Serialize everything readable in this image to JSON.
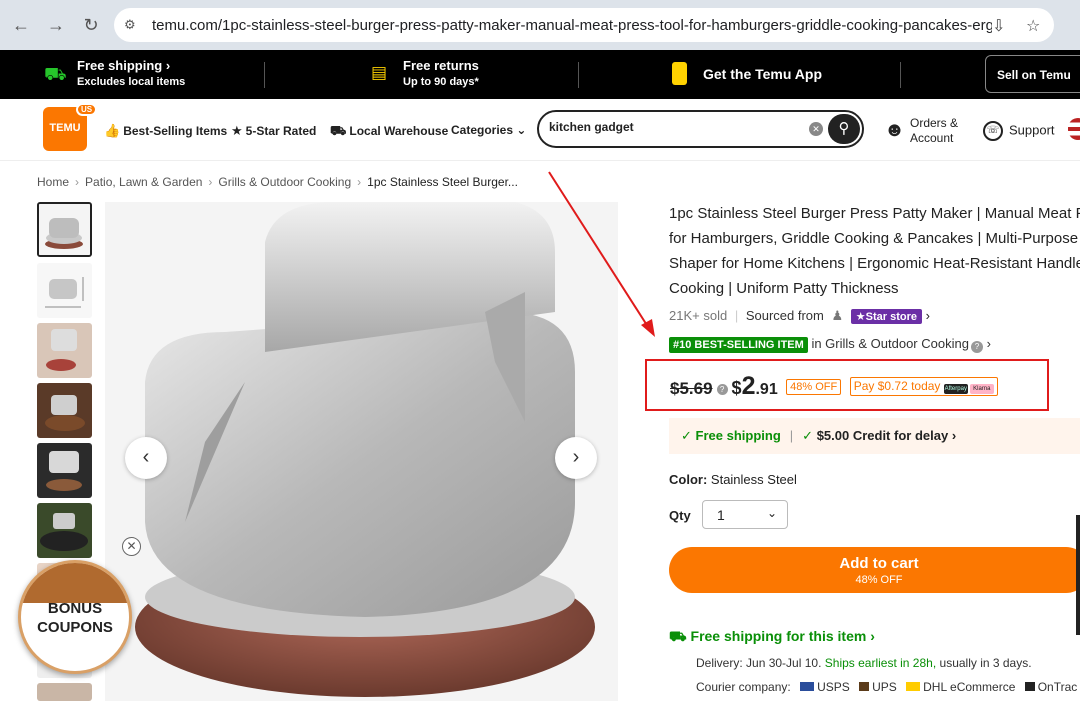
{
  "browser": {
    "url": "temu.com/1pc-stainless-steel-burger-press-patty-maker-manual-meat-press-tool-for-hamburgers-griddle-cooking-pancakes-ergonomic-..."
  },
  "promo": {
    "free_shipping_title": "Free shipping",
    "free_shipping_sub": "Excludes local items",
    "free_returns_title": "Free returns",
    "free_returns_sub": "Up to 90 days*",
    "app_label": "Get the Temu App",
    "sell_label": "Sell on Temu"
  },
  "header": {
    "logo_text": "TEMU",
    "logo_badge": "US",
    "nav": {
      "best_selling": "Best-Selling Items",
      "five_star": "5-Star Rated",
      "local_warehouse": "Local Warehouse",
      "categories": "Categories"
    },
    "search_value": "kitchen gadget",
    "orders_line1": "Orders &",
    "orders_line2": "Account",
    "support": "Support"
  },
  "breadcrumb": [
    "Home",
    "Patio, Lawn & Garden",
    "Grills & Outdoor Cooking",
    "1pc Stainless Steel Burger..."
  ],
  "product": {
    "title_lines": [
      "1pc Stainless Steel Burger Press Patty Maker | Manual Meat P",
      "for Hamburgers, Griddle Cooking & Pancakes | Multi-Purpose",
      "Shaper for Home Kitchens | Ergonomic Heat-Resistant Handle",
      "Cooking | Uniform Patty Thickness"
    ],
    "sold": "21K+ sold",
    "sourced_from": "Sourced from",
    "star_store": "Star store",
    "rank_badge": "#10 BEST-SELLING ITEM",
    "rank_category": "in Grills & Outdoor Cooking",
    "old_price": "$5.69",
    "price_symbol": "$",
    "price_int": "2",
    "price_dec": ".91",
    "discount": "48% OFF",
    "pay_today": "Pay $0.72 today",
    "pay_logo_1": "Afterpay",
    "pay_logo_2": "Klarna",
    "free_shipping": "Free shipping",
    "credit": "$5.00 Credit for delay",
    "color_label": "Color:",
    "color_value": "Stainless Steel",
    "qty_label": "Qty",
    "qty_value": "1",
    "add_to_cart": "Add to cart",
    "add_to_cart_sub": "48% OFF",
    "free_shipping_item": "Free shipping for this item",
    "delivery_label": "Delivery:",
    "delivery_dates": "Jun 30-Jul 10.",
    "delivery_ships": "Ships earliest in 28h,",
    "delivery_usual": "usually in 3 days.",
    "courier_label": "Courier company:",
    "couriers": [
      "USPS",
      "UPS",
      "DHL eCommerce",
      "OnTrac"
    ]
  },
  "bonus": {
    "line1": "BONUS",
    "line2": "COUPONS"
  },
  "colors": {
    "brand_orange": "#fb7701",
    "success_green": "#0a8f08",
    "highlight_red": "#e01b1b"
  }
}
